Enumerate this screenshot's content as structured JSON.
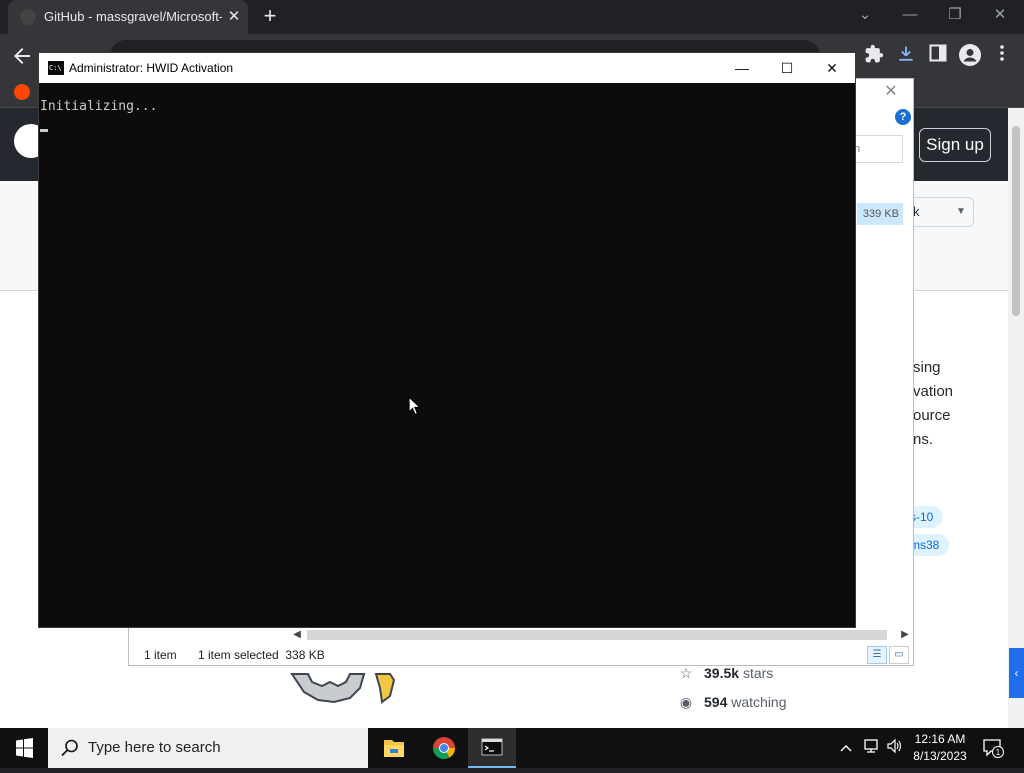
{
  "browser": {
    "tab_title": "GitHub - massgravel/Microsoft-A",
    "tab_close": "✕",
    "new_tab": "+",
    "win_min": "—",
    "win_max": "❐",
    "win_close": "✕",
    "tab_search": "⌄"
  },
  "github": {
    "signup_label": "Sign up",
    "fork_fragment": "k",
    "about_lines": [
      "sing",
      "vation",
      "ource",
      "ns."
    ],
    "topics": [
      "s-10",
      "ms38"
    ],
    "stats": [
      {
        "icon": "☆",
        "value": "39.5k",
        "label": "stars"
      },
      {
        "icon": "◉",
        "value": "594",
        "label": "watching"
      }
    ]
  },
  "explorer": {
    "search_fragment": "sion",
    "size_cell": "339 KB",
    "status_items": "1 item",
    "status_selected": "1 item selected  338 KB",
    "help": "?"
  },
  "cmd": {
    "title": "Administrator:  HWID Activation",
    "output": "Initializing...",
    "icon_text": "C:\\",
    "btn_min": "—",
    "btn_max": "☐",
    "btn_close": "✕"
  },
  "taskbar": {
    "search_placeholder": "Type here to search",
    "time": "12:16 AM",
    "date": "8/13/2023",
    "notification_count": "1"
  }
}
